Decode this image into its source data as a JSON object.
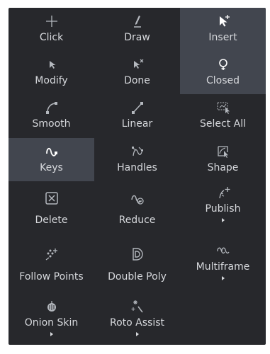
{
  "tools": {
    "click": {
      "label": "Click",
      "icon": "plus-icon"
    },
    "draw": {
      "label": "Draw",
      "icon": "pen-icon"
    },
    "insert": {
      "label": "Insert",
      "icon": "insert-point-icon"
    },
    "modify": {
      "label": "Modify",
      "icon": "cursor-arrow-icon"
    },
    "done": {
      "label": "Done",
      "icon": "cursor-done-icon"
    },
    "closed": {
      "label": "Closed",
      "icon": "closed-loop-icon"
    },
    "smooth": {
      "label": "Smooth",
      "icon": "smooth-curve-icon"
    },
    "linear": {
      "label": "Linear",
      "icon": "linear-line-icon"
    },
    "select_all": {
      "label": "Select All",
      "icon": "select-all-icon"
    },
    "keys": {
      "label": "Keys",
      "icon": "keys-curve-icon"
    },
    "handles": {
      "label": "Handles",
      "icon": "handles-icon"
    },
    "shape": {
      "label": "Shape",
      "icon": "shape-select-icon"
    },
    "delete": {
      "label": "Delete",
      "icon": "delete-box-icon"
    },
    "reduce": {
      "label": "Reduce",
      "icon": "reduce-points-icon"
    },
    "publish": {
      "label": "Publish",
      "icon": "publish-icon"
    },
    "follow_points": {
      "label": "Follow Points",
      "icon": "follow-points-icon"
    },
    "double_poly": {
      "label": "Double Poly",
      "icon": "double-poly-icon"
    },
    "multiframe": {
      "label": "Multiframe",
      "icon": "multiframe-icon"
    },
    "onion_skin": {
      "label": "Onion Skin",
      "icon": "onion-skin-icon"
    },
    "roto_assist": {
      "label": "Roto Assist",
      "icon": "roto-assist-icon"
    }
  },
  "active_tools": [
    "insert",
    "closed",
    "keys"
  ],
  "colors": {
    "panel_bg": "#27282c",
    "active_bg": "#42464f",
    "text": "#d6d8dc",
    "icon": "#b4b8be"
  }
}
